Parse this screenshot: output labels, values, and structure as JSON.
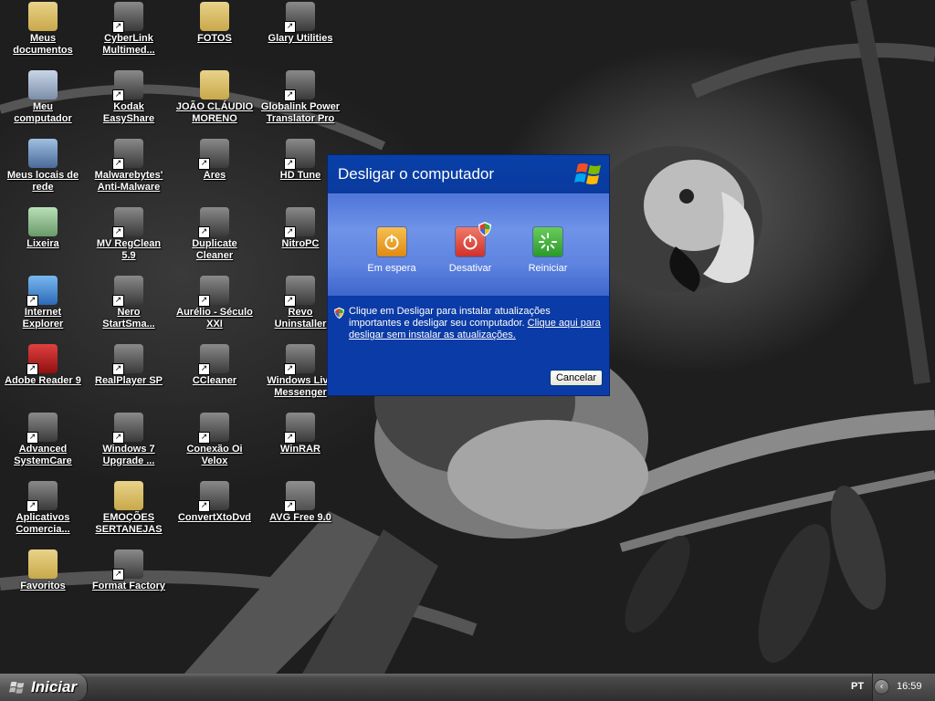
{
  "desktop": {
    "icons": [
      {
        "label": "Meus\ndocumentos",
        "glyph": "folder-docs-icon"
      },
      {
        "label": "CyberLink\nMultimed...",
        "glyph": "cyberlink-icon"
      },
      {
        "label": "FOTOS",
        "glyph": "folder-icon"
      },
      {
        "label": "Glary Utilities",
        "glyph": "glary-icon"
      },
      {
        "label": "Meu\ncomputador",
        "glyph": "computer-icon"
      },
      {
        "label": "Kodak\nEasyShare",
        "glyph": "kodak-icon"
      },
      {
        "label": "JOÃO CLÁUDIO\nMORENO",
        "glyph": "folder-icon"
      },
      {
        "label": "Globalink Power\nTranslator Pro",
        "glyph": "globe-icon"
      },
      {
        "label": "Meus locais de\nrede",
        "glyph": "network-icon"
      },
      {
        "label": "Malwarebytes'\nAnti-Malware",
        "glyph": "malwarebytes-icon"
      },
      {
        "label": "Ares",
        "glyph": "ares-icon"
      },
      {
        "label": "HD Tune",
        "glyph": "hdtune-icon"
      },
      {
        "label": "Lixeira",
        "glyph": "recycle-bin-icon"
      },
      {
        "label": "MV RegClean\n5.9",
        "glyph": "regclean-icon"
      },
      {
        "label": "Duplicate\nCleaner",
        "glyph": "duplicate-cleaner-icon"
      },
      {
        "label": "NitroPC",
        "glyph": "nitropc-icon"
      },
      {
        "label": "Internet\nExplorer",
        "glyph": "internet-explorer-icon"
      },
      {
        "label": "Nero\nStartSma...",
        "glyph": "nero-icon"
      },
      {
        "label": "Aurélio - Século\nXXI",
        "glyph": "aurelio-icon"
      },
      {
        "label": "Revo\nUninstaller",
        "glyph": "revo-icon"
      },
      {
        "label": "Adobe Reader 9",
        "glyph": "adobe-reader-icon"
      },
      {
        "label": "RealPlayer SP",
        "glyph": "realplayer-icon"
      },
      {
        "label": "CCleaner",
        "glyph": "ccleaner-icon"
      },
      {
        "label": "Windows Live\nMessenger",
        "glyph": "messenger-icon"
      },
      {
        "label": "Advanced\nSystemCare",
        "glyph": "advanced-systemcare-icon"
      },
      {
        "label": "Windows 7\nUpgrade ...",
        "glyph": "document-icon"
      },
      {
        "label": "Conexão Oi\nVelox",
        "glyph": "oi-velox-icon"
      },
      {
        "label": "WinRAR",
        "glyph": "winrar-icon"
      },
      {
        "label": "Aplicativos\nComercia...",
        "glyph": "apps-icon"
      },
      {
        "label": "EMOÇÕES\nSERTANEJAS",
        "glyph": "folder-icon"
      },
      {
        "label": "ConvertXtoDvd",
        "glyph": "convertxtodvd-icon"
      },
      {
        "label": "AVG Free 9.0",
        "glyph": "avg-icon"
      },
      {
        "label": "Favoritos",
        "glyph": "folder-icon"
      },
      {
        "label": "Format Factory",
        "glyph": "format-factory-icon"
      }
    ]
  },
  "dialog": {
    "title": "Desligar o computador",
    "buttons": {
      "standby": "Em espera",
      "shutdown": "Desativar",
      "restart": "Reiniciar"
    },
    "info_text": "Clique em Desligar para instalar atualizações importantes e desligar seu computador.",
    "info_link": "Clique aqui para desligar sem instalar as atualizações.",
    "cancel": "Cancelar"
  },
  "taskbar": {
    "start_label": "Iniciar",
    "language": "PT",
    "clock": "16:59"
  },
  "colors": {
    "dialog_blue": "#0b3ba6",
    "standby_orange": "#f0a020",
    "shutdown_red": "#e0443a",
    "restart_green": "#3aa83a"
  }
}
